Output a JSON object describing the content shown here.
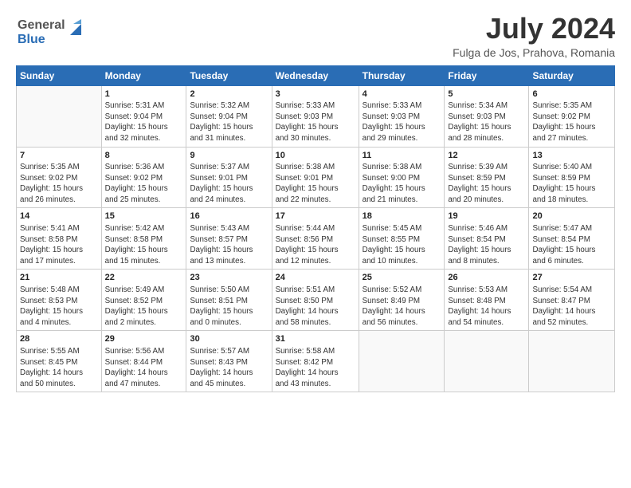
{
  "header": {
    "logo_line1": "General",
    "logo_line2": "Blue",
    "month_title": "July 2024",
    "location": "Fulga de Jos, Prahova, Romania"
  },
  "days_of_week": [
    "Sunday",
    "Monday",
    "Tuesday",
    "Wednesday",
    "Thursday",
    "Friday",
    "Saturday"
  ],
  "weeks": [
    [
      {
        "day": "",
        "info": ""
      },
      {
        "day": "1",
        "info": "Sunrise: 5:31 AM\nSunset: 9:04 PM\nDaylight: 15 hours\nand 32 minutes."
      },
      {
        "day": "2",
        "info": "Sunrise: 5:32 AM\nSunset: 9:04 PM\nDaylight: 15 hours\nand 31 minutes."
      },
      {
        "day": "3",
        "info": "Sunrise: 5:33 AM\nSunset: 9:03 PM\nDaylight: 15 hours\nand 30 minutes."
      },
      {
        "day": "4",
        "info": "Sunrise: 5:33 AM\nSunset: 9:03 PM\nDaylight: 15 hours\nand 29 minutes."
      },
      {
        "day": "5",
        "info": "Sunrise: 5:34 AM\nSunset: 9:03 PM\nDaylight: 15 hours\nand 28 minutes."
      },
      {
        "day": "6",
        "info": "Sunrise: 5:35 AM\nSunset: 9:02 PM\nDaylight: 15 hours\nand 27 minutes."
      }
    ],
    [
      {
        "day": "7",
        "info": "Sunrise: 5:35 AM\nSunset: 9:02 PM\nDaylight: 15 hours\nand 26 minutes."
      },
      {
        "day": "8",
        "info": "Sunrise: 5:36 AM\nSunset: 9:02 PM\nDaylight: 15 hours\nand 25 minutes."
      },
      {
        "day": "9",
        "info": "Sunrise: 5:37 AM\nSunset: 9:01 PM\nDaylight: 15 hours\nand 24 minutes."
      },
      {
        "day": "10",
        "info": "Sunrise: 5:38 AM\nSunset: 9:01 PM\nDaylight: 15 hours\nand 22 minutes."
      },
      {
        "day": "11",
        "info": "Sunrise: 5:38 AM\nSunset: 9:00 PM\nDaylight: 15 hours\nand 21 minutes."
      },
      {
        "day": "12",
        "info": "Sunrise: 5:39 AM\nSunset: 8:59 PM\nDaylight: 15 hours\nand 20 minutes."
      },
      {
        "day": "13",
        "info": "Sunrise: 5:40 AM\nSunset: 8:59 PM\nDaylight: 15 hours\nand 18 minutes."
      }
    ],
    [
      {
        "day": "14",
        "info": "Sunrise: 5:41 AM\nSunset: 8:58 PM\nDaylight: 15 hours\nand 17 minutes."
      },
      {
        "day": "15",
        "info": "Sunrise: 5:42 AM\nSunset: 8:58 PM\nDaylight: 15 hours\nand 15 minutes."
      },
      {
        "day": "16",
        "info": "Sunrise: 5:43 AM\nSunset: 8:57 PM\nDaylight: 15 hours\nand 13 minutes."
      },
      {
        "day": "17",
        "info": "Sunrise: 5:44 AM\nSunset: 8:56 PM\nDaylight: 15 hours\nand 12 minutes."
      },
      {
        "day": "18",
        "info": "Sunrise: 5:45 AM\nSunset: 8:55 PM\nDaylight: 15 hours\nand 10 minutes."
      },
      {
        "day": "19",
        "info": "Sunrise: 5:46 AM\nSunset: 8:54 PM\nDaylight: 15 hours\nand 8 minutes."
      },
      {
        "day": "20",
        "info": "Sunrise: 5:47 AM\nSunset: 8:54 PM\nDaylight: 15 hours\nand 6 minutes."
      }
    ],
    [
      {
        "day": "21",
        "info": "Sunrise: 5:48 AM\nSunset: 8:53 PM\nDaylight: 15 hours\nand 4 minutes."
      },
      {
        "day": "22",
        "info": "Sunrise: 5:49 AM\nSunset: 8:52 PM\nDaylight: 15 hours\nand 2 minutes."
      },
      {
        "day": "23",
        "info": "Sunrise: 5:50 AM\nSunset: 8:51 PM\nDaylight: 15 hours\nand 0 minutes."
      },
      {
        "day": "24",
        "info": "Sunrise: 5:51 AM\nSunset: 8:50 PM\nDaylight: 14 hours\nand 58 minutes."
      },
      {
        "day": "25",
        "info": "Sunrise: 5:52 AM\nSunset: 8:49 PM\nDaylight: 14 hours\nand 56 minutes."
      },
      {
        "day": "26",
        "info": "Sunrise: 5:53 AM\nSunset: 8:48 PM\nDaylight: 14 hours\nand 54 minutes."
      },
      {
        "day": "27",
        "info": "Sunrise: 5:54 AM\nSunset: 8:47 PM\nDaylight: 14 hours\nand 52 minutes."
      }
    ],
    [
      {
        "day": "28",
        "info": "Sunrise: 5:55 AM\nSunset: 8:45 PM\nDaylight: 14 hours\nand 50 minutes."
      },
      {
        "day": "29",
        "info": "Sunrise: 5:56 AM\nSunset: 8:44 PM\nDaylight: 14 hours\nand 47 minutes."
      },
      {
        "day": "30",
        "info": "Sunrise: 5:57 AM\nSunset: 8:43 PM\nDaylight: 14 hours\nand 45 minutes."
      },
      {
        "day": "31",
        "info": "Sunrise: 5:58 AM\nSunset: 8:42 PM\nDaylight: 14 hours\nand 43 minutes."
      },
      {
        "day": "",
        "info": ""
      },
      {
        "day": "",
        "info": ""
      },
      {
        "day": "",
        "info": ""
      }
    ]
  ]
}
